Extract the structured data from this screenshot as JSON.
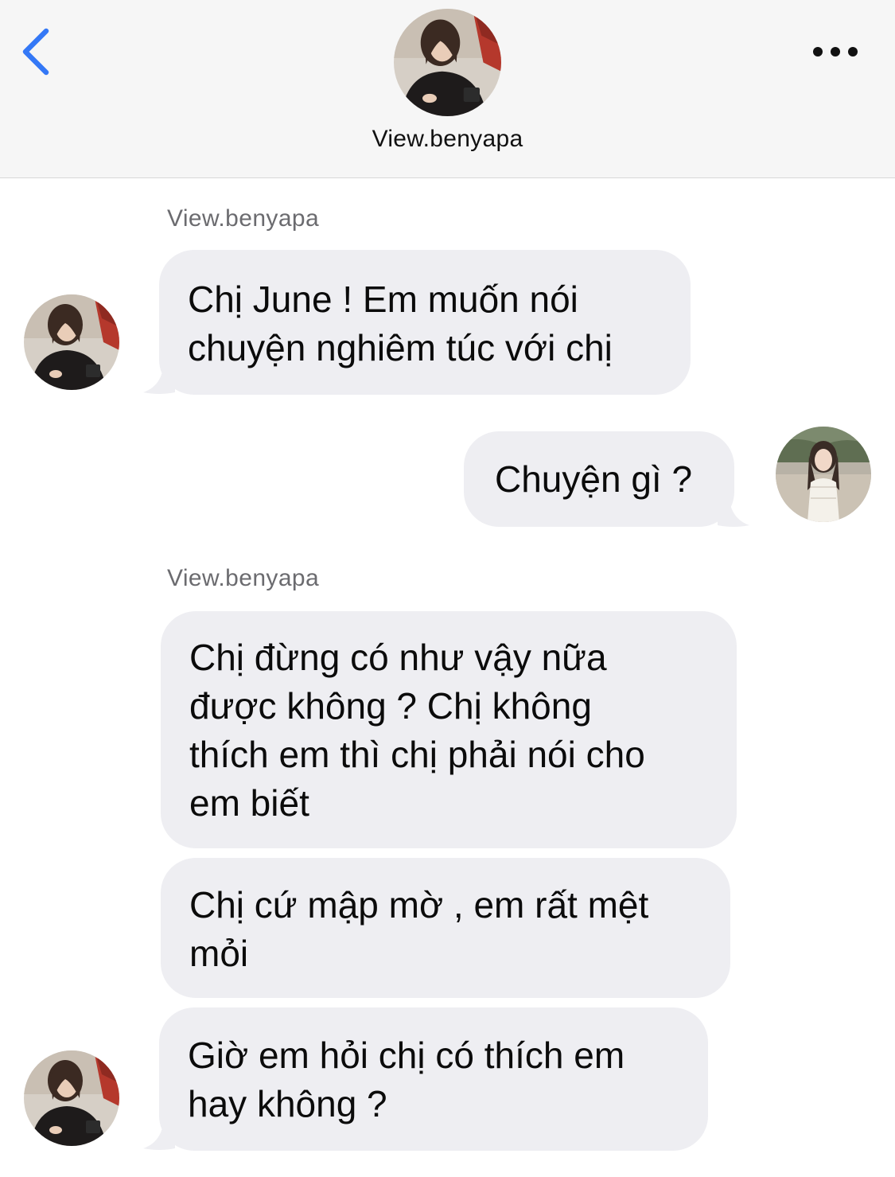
{
  "header": {
    "contact_name": "View.benyapa",
    "back_icon": "chevron-left-icon",
    "more_icon": "more-dots-icon",
    "accent_color": "#3478f6"
  },
  "messages": [
    {
      "sender_label": "View.benyapa",
      "direction": "incoming",
      "lines": [
        "Chị June ! Em muốn nói",
        "chuyện nghiêm túc với chị"
      ]
    },
    {
      "direction": "outgoing",
      "lines": [
        "Chuyện gì ?"
      ]
    },
    {
      "sender_label": "View.benyapa",
      "direction": "incoming",
      "lines": [
        "Chị đừng có như vậy nữa",
        "được không ? Chị không",
        "thích em thì chị phải nói cho",
        "em biết"
      ]
    },
    {
      "direction": "incoming",
      "lines": [
        "Chị cứ mập mờ , em rất mệt",
        "mỏi"
      ]
    },
    {
      "direction": "incoming",
      "lines": [
        "Giờ em hỏi chị có thích em",
        "hay không ?"
      ]
    }
  ],
  "colors": {
    "bubble": "#eeeef2",
    "header_bg": "#f6f6f6",
    "label": "#6b6b6f"
  }
}
